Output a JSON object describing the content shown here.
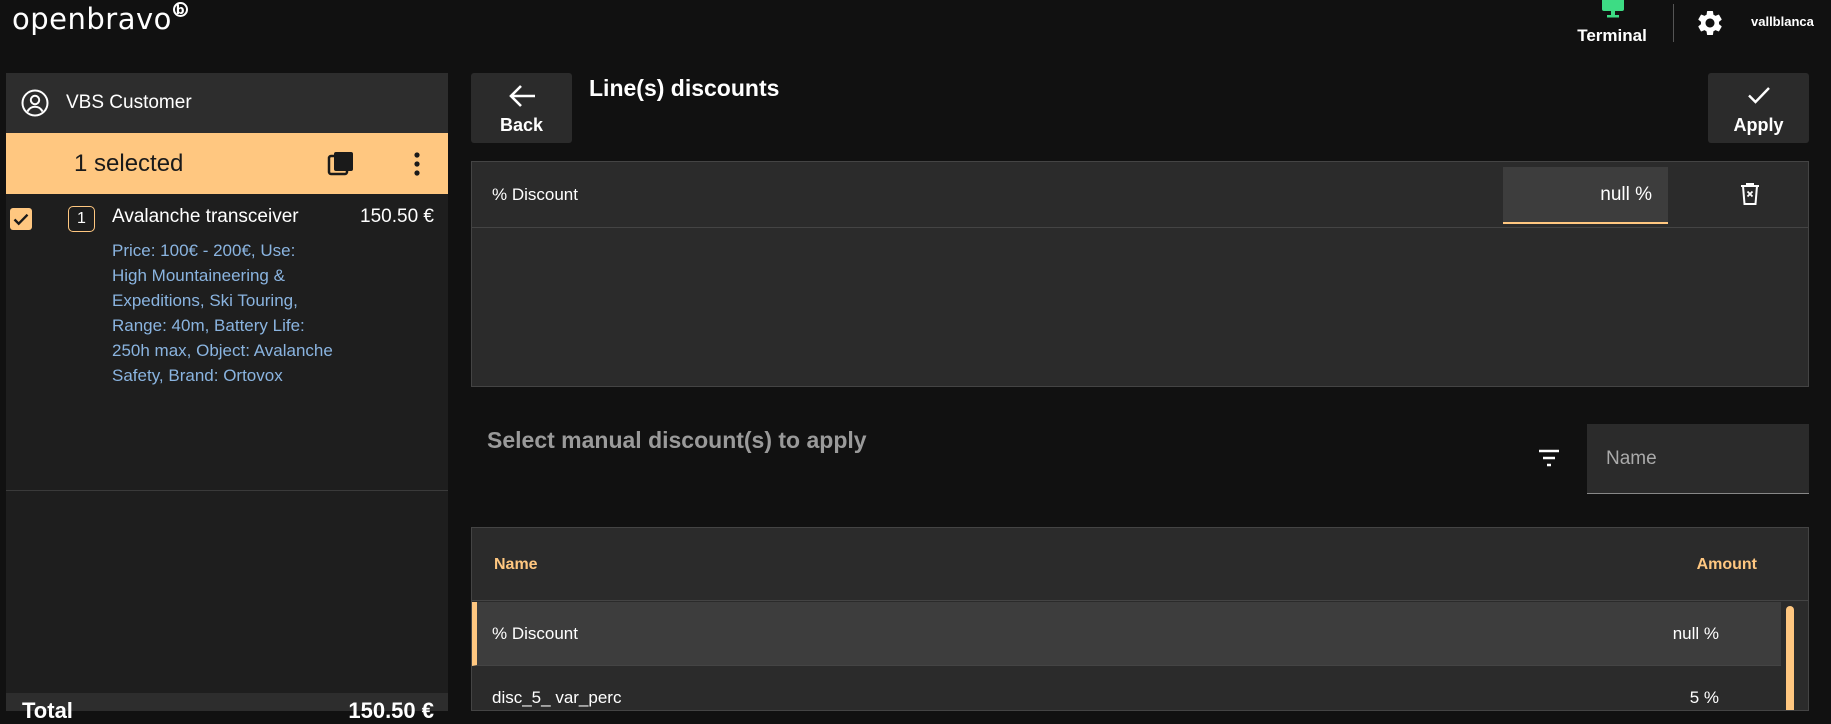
{
  "header": {
    "logo_text": "openbravo",
    "logo_mark": "b",
    "terminal_label": "Terminal",
    "username": "vallblanca",
    "terminal_icon": "monitor-icon",
    "settings_icon": "gear-icon",
    "colors": {
      "terminal_icon": "#3ddc84",
      "accent": "#ffc780"
    }
  },
  "ticket": {
    "customer_icon": "user-circle-icon",
    "customer_name": "VBS Customer",
    "selection_text": "1 selected",
    "lines": [
      {
        "checked": true,
        "qty": "1",
        "product": "Avalanche transceiver",
        "price": "150.50 €",
        "description": "Price: 100€ - 200€, Use: High Mountaineering & Expeditions, Ski Touring, Range: 40m, Battery Life: 250h max, Object: Avalanche Safety, Brand: Ortovox"
      }
    ],
    "total_label": "Total",
    "total_value": "150.50 €"
  },
  "discounts": {
    "back_label": "Back",
    "title": "Line(s) discounts",
    "apply_label": "Apply",
    "applied": [
      {
        "name": "% Discount",
        "value": "null %"
      }
    ],
    "section_title": "Select manual discount(s) to apply",
    "name_filter_placeholder": "Name",
    "table": {
      "col_name": "Name",
      "col_amount": "Amount",
      "rows": [
        {
          "name": "% Discount",
          "amount": "null %",
          "selected": true
        },
        {
          "name": "disc_5_ var_perc",
          "amount": "5 %",
          "selected": false
        }
      ]
    }
  }
}
